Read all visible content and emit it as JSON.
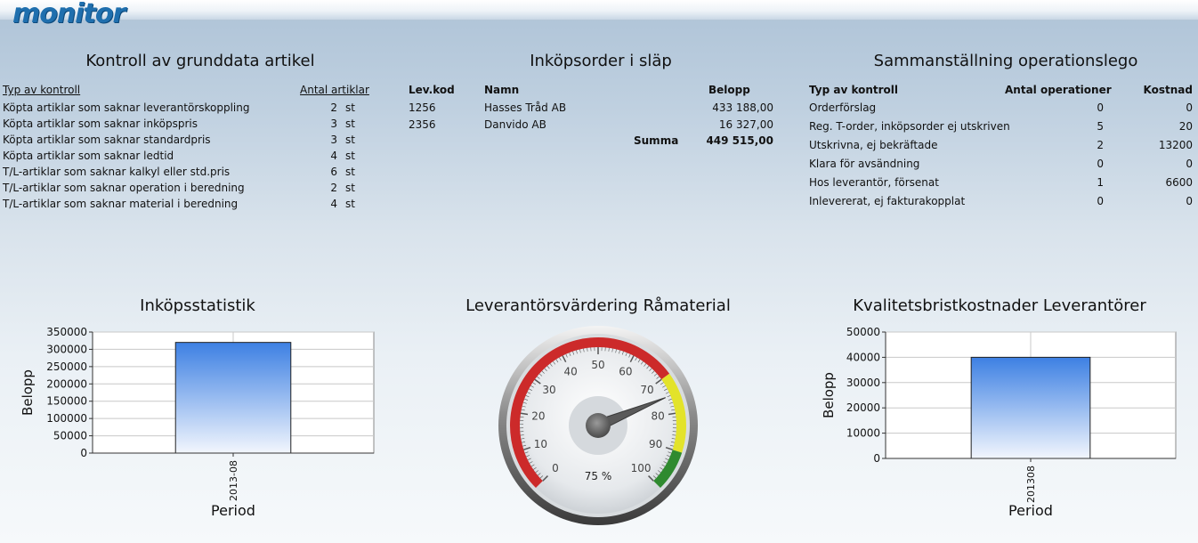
{
  "app": {
    "logo": "monitor"
  },
  "panel1": {
    "title": "Kontroll av grunddata artikel",
    "col_type": "Typ av kontroll",
    "col_count": "Antal artiklar",
    "rows": [
      {
        "label": "Köpta artiklar som saknar leverantörskoppling",
        "count": "2",
        "unit": "st"
      },
      {
        "label": "Köpta artiklar som saknar inköpspris",
        "count": "3",
        "unit": "st"
      },
      {
        "label": "Köpta artiklar som saknar standardpris",
        "count": "3",
        "unit": "st"
      },
      {
        "label": "Köpta artiklar som saknar ledtid",
        "count": "4",
        "unit": "st"
      },
      {
        "label": "T/L-artiklar som saknar kalkyl eller std.pris",
        "count": "6",
        "unit": "st"
      },
      {
        "label": "T/L-artiklar som saknar operation i beredning",
        "count": "2",
        "unit": "st"
      },
      {
        "label": "T/L-artiklar som saknar material i beredning",
        "count": "4",
        "unit": "st"
      }
    ]
  },
  "panel2": {
    "title": "Inköpsorder i släp",
    "col_code": "Lev.kod",
    "col_name": "Namn",
    "col_amount": "Belopp",
    "rows": [
      {
        "code": "1256",
        "name": "Hasses Tråd AB",
        "amount": "433 188,00"
      },
      {
        "code": "2356",
        "name": "Danvido AB",
        "amount": "16 327,00"
      }
    ],
    "sum_label": "Summa",
    "sum_value": "449 515,00"
  },
  "panel3": {
    "title": "Sammanställning operationslego",
    "col_type": "Typ av kontroll",
    "col_ops": "Antal operationer",
    "col_cost": "Kostnad",
    "rows": [
      {
        "label": "Orderförslag",
        "ops": "0",
        "cost": "0"
      },
      {
        "label": "Reg. T-order, inköpsorder ej utskriven",
        "ops": "5",
        "cost": "20"
      },
      {
        "label": "Utskrivna, ej bekräftade",
        "ops": "2",
        "cost": "13200"
      },
      {
        "label": "Klara för avsändning",
        "ops": "0",
        "cost": "0"
      },
      {
        "label": "Hos leverantör, försenat",
        "ops": "1",
        "cost": "6600"
      },
      {
        "label": "Inlevererat, ej fakturakopplat",
        "ops": "0",
        "cost": "0"
      }
    ]
  },
  "chart_data": [
    {
      "type": "bar",
      "title": "Inköpsstatistik",
      "xlabel": "Period",
      "ylabel": "Belopp",
      "categories": [
        "2013-08"
      ],
      "values": [
        320000
      ],
      "ylim": [
        0,
        350000
      ],
      "yticks": [
        "0",
        "50000",
        "100000",
        "150000",
        "200000",
        "250000",
        "300000",
        "350000"
      ],
      "grid": true,
      "bar_color_top": "#3d80e3",
      "bar_color_bottom": "#f2f6fd"
    },
    {
      "type": "gauge",
      "title": "Leverantörsvärdering Råmaterial",
      "value": 75,
      "value_label": "75 %",
      "range": [
        0,
        100
      ],
      "tick_labels": [
        "0",
        "10",
        "20",
        "30",
        "40",
        "50",
        "60",
        "70",
        "80",
        "90",
        "100"
      ],
      "bands": [
        {
          "from": 0,
          "to": 70,
          "color": "#cc2a2a"
        },
        {
          "from": 70,
          "to": 90,
          "color": "#e3e32a"
        },
        {
          "from": 90,
          "to": 100,
          "color": "#2f8a2f"
        }
      ]
    },
    {
      "type": "bar",
      "title": "Kvalitetsbristkostnader Leverantörer",
      "xlabel": "Period",
      "ylabel": "Belopp",
      "categories": [
        "201308"
      ],
      "values": [
        40000
      ],
      "ylim": [
        0,
        50000
      ],
      "yticks": [
        "0",
        "10000",
        "20000",
        "30000",
        "40000",
        "50000"
      ],
      "grid": true,
      "bar_color_top": "#3d80e3",
      "bar_color_bottom": "#f2f6fd"
    }
  ]
}
